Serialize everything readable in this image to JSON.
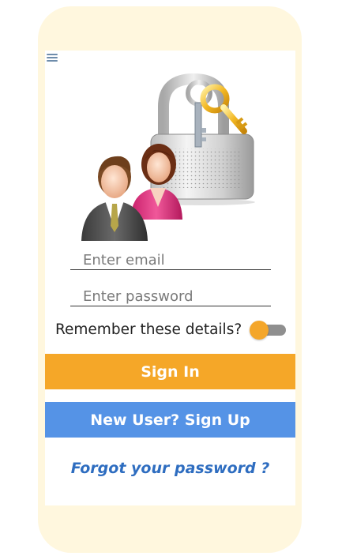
{
  "icons": {
    "menu": "hamburger-menu-icon",
    "hero": "users-with-padlock-and-keys-icon"
  },
  "form": {
    "email_placeholder": "Enter email",
    "password_placeholder": "Enter password",
    "remember_label": "Remember these details?",
    "remember_enabled": true
  },
  "buttons": {
    "sign_in": "Sign In",
    "sign_up": "New User? Sign Up"
  },
  "links": {
    "forgot_password": "Forgot your password ?"
  },
  "colors": {
    "phone_frame": "#fff7de",
    "sign_in": "#f5a728",
    "sign_up": "#5593e6",
    "link": "#2e6dc0",
    "toggle_knob": "#f4a62a"
  }
}
